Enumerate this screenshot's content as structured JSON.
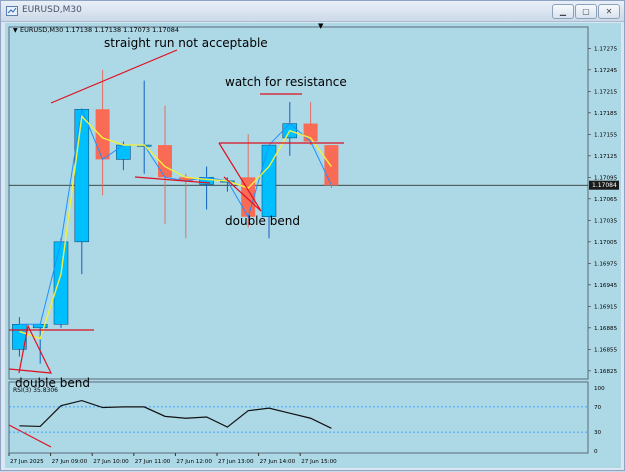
{
  "window": {
    "title": "EURUSD,M30"
  },
  "chart_header": {
    "symbol_info": "EURUSD,M30  1.17138 1.17138 1.17073 1.17084"
  },
  "annotations": {
    "straight_run": "straight run not acceptable",
    "watch_resistance": "watch for resistance",
    "double_bend_main": "double bend",
    "double_bend_lower": "double bend"
  },
  "current_price_label": "1.17084",
  "rsi_label": "RSI(3) 35.8306",
  "colors": {
    "background": "#add8e6",
    "bull_candle": "#00bfff",
    "bear_candle": "#fa6b55",
    "annotation_line": "#e01020",
    "ma_line": "#f0f040",
    "price_line": "#1e90ff"
  },
  "chart_data": {
    "type": "candlestick",
    "symbol": "EURUSD",
    "timeframe": "M30",
    "price_axis_ticks": [
      "1.17275",
      "1.17245",
      "1.17215",
      "1.17185",
      "1.17155",
      "1.17125",
      "1.17095",
      "1.17065",
      "1.17035",
      "1.17005",
      "1.16975",
      "1.16945",
      "1.16915",
      "1.16885",
      "1.16855",
      "1.16825"
    ],
    "time_axis_ticks": [
      "27 Jun 2025",
      "27 Jun 09:00",
      "27 Jun 10:00",
      "27 Jun 11:00",
      "27 Jun 12:00",
      "27 Jun 13:00",
      "27 Jun 14:00",
      "27 Jun 15:00"
    ],
    "rsi_axis_ticks": [
      "100",
      "70",
      "30",
      "0"
    ],
    "rsi_levels": [
      70,
      30
    ],
    "current_price": 1.17084,
    "candles": [
      {
        "o": 1.16855,
        "h": 1.169,
        "l": 1.16845,
        "c": 1.1689
      },
      {
        "o": 1.16885,
        "h": 1.1689,
        "l": 1.16835,
        "c": 1.1689
      },
      {
        "o": 1.1689,
        "h": 1.1701,
        "l": 1.16885,
        "c": 1.17005
      },
      {
        "o": 1.17005,
        "h": 1.1719,
        "l": 1.1696,
        "c": 1.1719
      },
      {
        "o": 1.1719,
        "h": 1.17245,
        "l": 1.1707,
        "c": 1.1712
      },
      {
        "o": 1.1712,
        "h": 1.17145,
        "l": 1.17105,
        "c": 1.1714
      },
      {
        "o": 1.1714,
        "h": 1.1723,
        "l": 1.171,
        "c": 1.1714
      },
      {
        "o": 1.1714,
        "h": 1.17195,
        "l": 1.1703,
        "c": 1.17095
      },
      {
        "o": 1.17095,
        "h": 1.171,
        "l": 1.1701,
        "c": 1.1709
      },
      {
        "o": 1.17085,
        "h": 1.1711,
        "l": 1.1705,
        "c": 1.17095
      },
      {
        "o": 1.1709,
        "h": 1.17095,
        "l": 1.17075,
        "c": 1.1709
      },
      {
        "o": 1.17095,
        "h": 1.17155,
        "l": 1.17025,
        "c": 1.1704
      },
      {
        "o": 1.1704,
        "h": 1.1714,
        "l": 1.1701,
        "c": 1.1714
      },
      {
        "o": 1.1715,
        "h": 1.172,
        "l": 1.17125,
        "c": 1.1717
      },
      {
        "o": 1.1717,
        "h": 1.172,
        "l": 1.1714,
        "c": 1.17145
      },
      {
        "o": 1.1714,
        "h": 1.1714,
        "l": 1.1708,
        "c": 1.17084
      }
    ],
    "ma": [
      1.1688,
      1.1687,
      1.1696,
      1.1718,
      1.1715,
      1.1714,
      1.1714,
      1.1711,
      1.17095,
      1.17092,
      1.1709,
      1.1708,
      1.1711,
      1.1716,
      1.1715,
      1.1711
    ],
    "rsi": [
      40,
      39,
      72,
      80,
      69,
      70,
      70,
      55,
      52,
      54,
      38,
      64,
      68,
      60,
      52,
      36
    ]
  }
}
